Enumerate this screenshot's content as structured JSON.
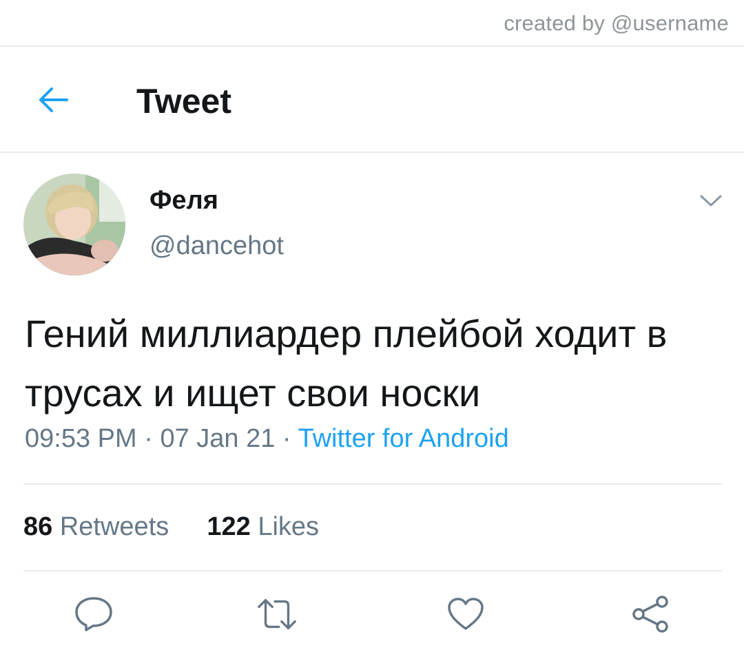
{
  "credit": "created by @username",
  "header": {
    "title": "Tweet",
    "back_icon": "arrow-left-icon"
  },
  "colors": {
    "accent": "#1da1f2",
    "text": "#14171a",
    "secondary": "#657786",
    "divider": "#e6ecf0"
  },
  "tweet": {
    "display_name": "Феля",
    "handle": "@dancehot",
    "text": "Гений миллиардер плейбой ходит в трусах и ищет свои носки",
    "time": "09:53 PM",
    "date": "07 Jan 21",
    "separator": "·",
    "source": "Twitter for Android",
    "retweets_count": "86",
    "retweets_label": "Retweets",
    "likes_count": "122",
    "likes_label": "Likes"
  },
  "actions": [
    {
      "name": "reply",
      "icon": "reply-icon"
    },
    {
      "name": "retweet",
      "icon": "retweet-icon"
    },
    {
      "name": "like",
      "icon": "heart-icon"
    },
    {
      "name": "share",
      "icon": "share-icon"
    }
  ]
}
